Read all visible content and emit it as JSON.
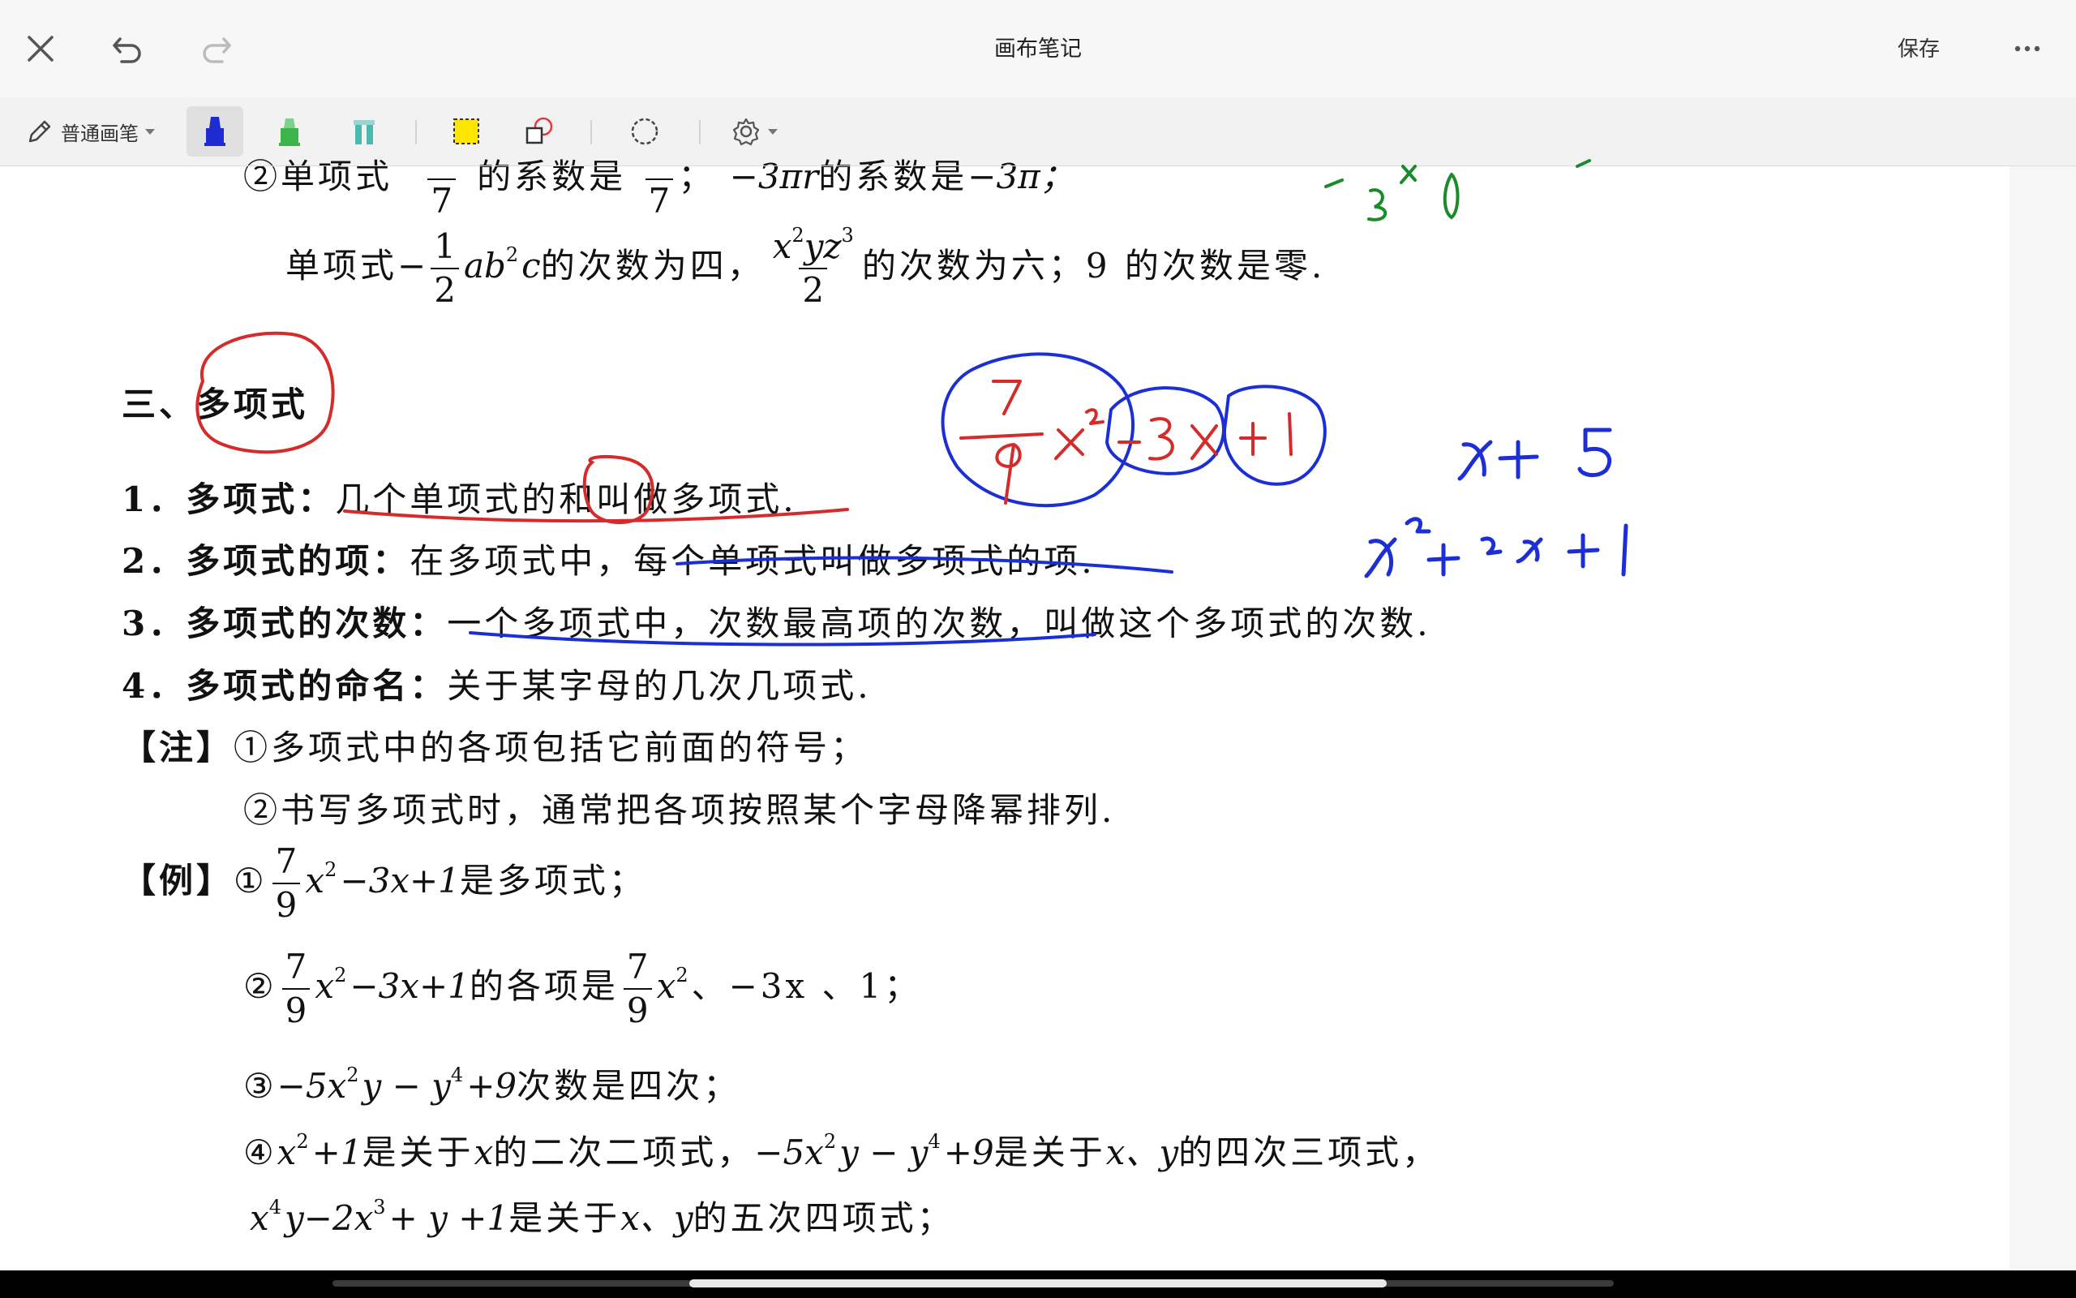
{
  "window": {
    "title": "画布笔记",
    "save_label": "保存"
  },
  "icons": {
    "close": "close-icon",
    "undo": "undo-icon",
    "redo": "redo-icon",
    "more": "more-icon"
  },
  "toolbar": {
    "pen_type_label": "普通画笔",
    "tools": [
      "pencil-icon",
      "blue-marker-icon",
      "green-highlighter-icon",
      "teal-highlighter-icon",
      "yellow-rect-select-icon",
      "shape-icon",
      "lasso-icon",
      "settings-icon"
    ],
    "colors": {
      "blue_pen": "#1d2bd1",
      "green_pen": "#3bb54a",
      "teal_pen": "#4cb9b0",
      "yellow": "#ffe600"
    }
  },
  "document": {
    "top_partial": {
      "circ": "②",
      "a": "单项式",
      "a_den": "7",
      "b": "的系数是",
      "b_den": "7",
      "c": "；",
      "d": "−3πr",
      "e": "的系数是",
      "f": "−3π；"
    },
    "mono_line": {
      "p1": "单项式",
      "neg": "−",
      "f1_num": "1",
      "f1_den": "2",
      "expr1": "ab",
      "exp1": "2",
      "expr1b": "c",
      "t1": "的次数为四，",
      "f2_num_a": "x",
      "f2_exp_a": "2",
      "f2_num_b": "yz",
      "f2_exp_b": "3",
      "f2_den": "2",
      "t2": "的次数为六；9 的次数是零."
    },
    "section_title": "三、多项式",
    "items": [
      {
        "label": "1．多项式：",
        "text": "几个单项式的和叫做多项式."
      },
      {
        "label": "2．多项式的项：",
        "text": "在多项式中，每个单项式叫做多项式的项."
      },
      {
        "label": "3．多项式的次数：",
        "text": "一个多项式中，次数最高项的次数，叫做这个多项式的次数."
      },
      {
        "label": "4．多项式的命名：",
        "text": "关于某字母的几次几项式."
      }
    ],
    "note": {
      "tag": "【注】",
      "l1": "①多项式中的各项包括它前面的符号；",
      "l2": "②书写多项式时，通常把各项按照某个字母降幂排列."
    },
    "example": {
      "tag": "【例】",
      "e1": {
        "c": "①",
        "num": "7",
        "den": "9",
        "x": "x",
        "exp": "2",
        "rest": "−3x+1",
        "tail": "是多项式；"
      },
      "e2": {
        "c": "②",
        "num": "7",
        "den": "9",
        "x": "x",
        "exp": "2",
        "rest": "−3x+1",
        "mid": "的各项是",
        "num2": "7",
        "den2": "9",
        "x2": "x",
        "exp2": "2",
        "tail": "、−3x 、1；"
      },
      "e3": {
        "c": "③",
        "a": "−5x",
        "exp_a": "2",
        "b": "y − y",
        "exp_b": "4",
        "c2": "+9",
        "tail": "次数是四次；"
      },
      "e4": {
        "c": "④",
        "a": "x",
        "exp_a": "2",
        "b": "+1",
        "t1": "是关于",
        "x": "x",
        "t2": "的二次二项式，",
        "p": "−5x",
        "exp_p": "2",
        "q": "y − y",
        "exp_q": "4",
        "r": "+9",
        "t3": "是关于",
        "xy": "x、y",
        "t4": "的四次三项式，"
      },
      "e5": {
        "a": "x",
        "exp_a": "4",
        "b": "y−2x",
        "exp_b": "3",
        "c2": "+ y +1",
        "t1": "是关于",
        "xy": "x、y",
        "t2": "的五次四项式；"
      }
    },
    "handwriting": {
      "red": "#d42b2b",
      "blue": "#1c2fd6",
      "green": "#1a8a2a"
    }
  }
}
